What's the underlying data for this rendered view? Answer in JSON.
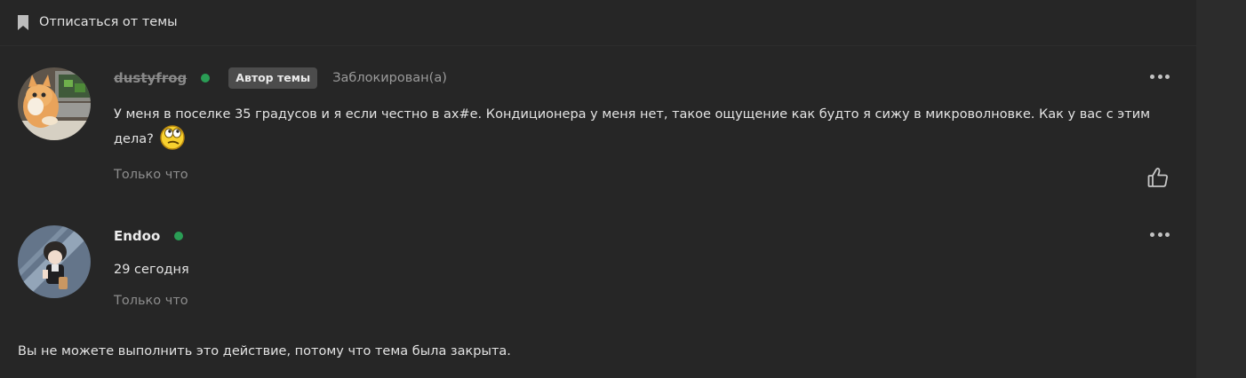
{
  "topic": {
    "unsubscribe_label": "Отписаться от темы",
    "closed_message": "Вы не можете выполнить это действие, потому что тема была закрыта."
  },
  "posts": [
    {
      "username": "dustyfrog",
      "online": true,
      "author_badge": "Автор темы",
      "status": "Заблокирован(а)",
      "text": "У меня в поселке 35 градусов и я если честно в ах#е. Кондиционера у меня нет, такое ощущение как будто я сижу в микроволновке. Как у вас с этим дела?",
      "emoji": "thinking-smiley",
      "time": "Только что"
    },
    {
      "username": "Endoo",
      "online": true,
      "text": "29 сегодня",
      "time": "Только что"
    }
  ],
  "icons": {
    "bookmark": "bookmark-icon",
    "more": "more-icon",
    "like": "thumbs-up-icon",
    "online": "online-indicator"
  },
  "colors": {
    "background": "#262626",
    "online": "#2a9d55",
    "badge_bg": "#4c4c4c",
    "muted_text": "#8d8d8d"
  }
}
